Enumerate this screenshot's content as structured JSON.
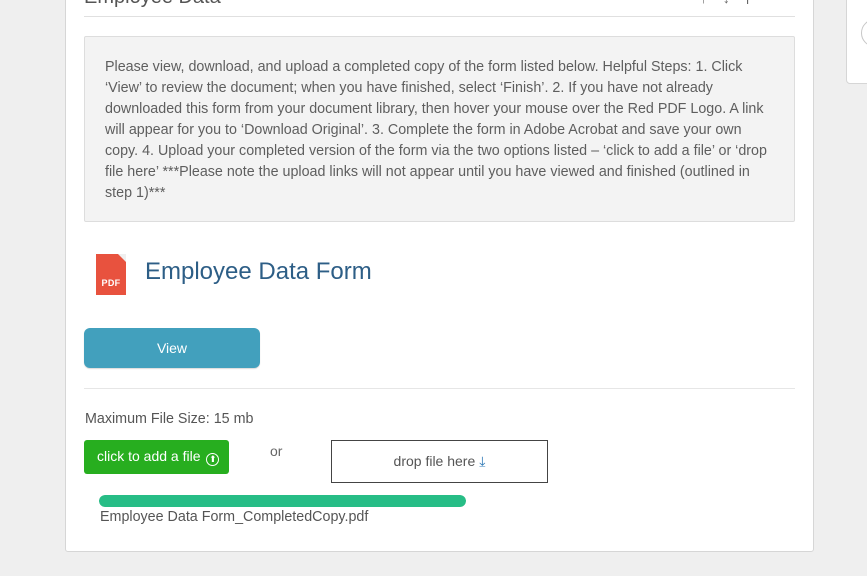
{
  "section": {
    "title": "Employee Data",
    "header_right_text": "↑ ↓ |"
  },
  "instructions": {
    "text": "Please view, download, and upload a completed copy of the form listed below. Helpful Steps: 1. Click ‘View’ to review the document; when you have finished, select ‘Finish’. 2. If you have not already downloaded this form from your document library, then hover your mouse over the Red PDF Logo. A link will appear for you to ‘Download Original’. 3. Complete the form in Adobe Acrobat and save your own copy. 4. Upload your completed version of the form via the two options listed – ‘click to add a file’ or ‘drop file here’ ***Please note the upload links will not appear until you have viewed and finished (outlined in step 1)***"
  },
  "form": {
    "icon_label": "PDF",
    "title": "Employee Data Form",
    "view_label": "View"
  },
  "upload": {
    "max_size_label": "Maximum File Size: 15 mb",
    "add_file_label": "click to add a file",
    "add_file_icon": "⬆",
    "or_label": "or",
    "drop_label": "drop file here",
    "drop_icon": "⤓",
    "progress": 1.0,
    "file_name": "Employee Data Form_CompletedCopy.pdf"
  },
  "colors": {
    "accent_view": "#42a0bd",
    "accent_add": "#27ae1f",
    "progress": "#27bd86",
    "pdf_red": "#e8523e",
    "title_blue": "#2d5e86"
  }
}
